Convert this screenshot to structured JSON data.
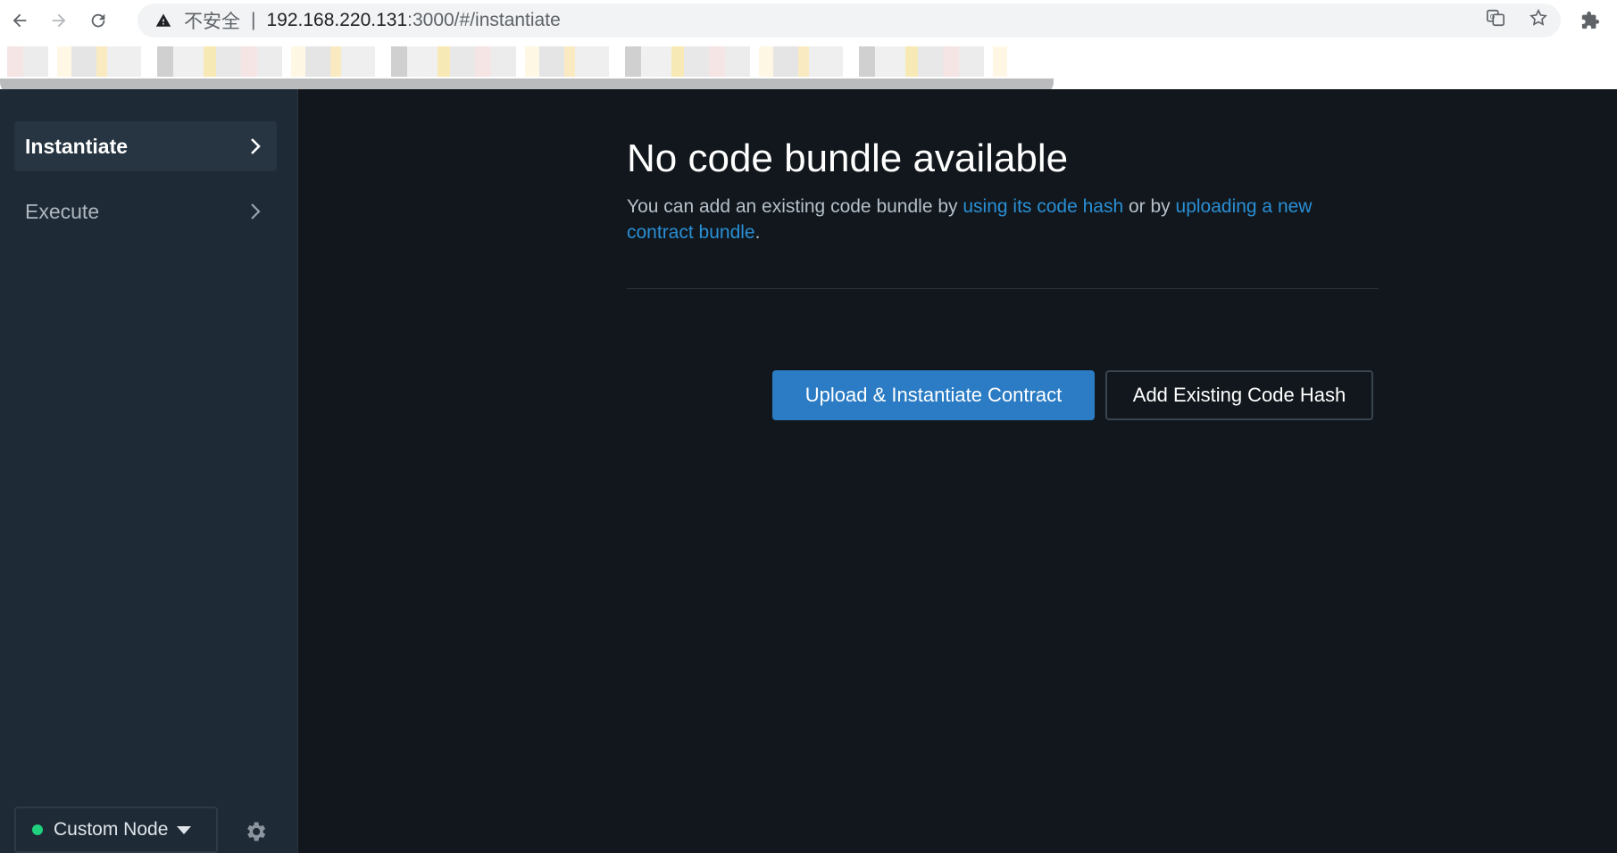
{
  "browser": {
    "insecure_label": "不安全",
    "separator": "|",
    "url_host": "192.168.220.131",
    "url_path": ":3000/#/instantiate",
    "icons": [
      "back-arrow-icon",
      "forward-arrow-icon",
      "reload-icon",
      "warning-icon",
      "translate-icon",
      "star-icon",
      "extensions-icon",
      "reading-list-icon"
    ]
  },
  "sidebar": {
    "items": [
      {
        "label": "Instantiate",
        "active": true
      },
      {
        "label": "Execute",
        "active": false
      }
    ],
    "node_selector": {
      "label": "Custom Node",
      "status_color": "#1fd17f"
    }
  },
  "main": {
    "title": "No code bundle available",
    "description": {
      "prefix": "You can add an existing code bundle by ",
      "link1": "using its code hash",
      "middle": " or by ",
      "link2": "uploading a new contract bundle",
      "suffix": "."
    },
    "primary_button": "Upload & Instantiate Contract",
    "secondary_button": "Add Existing Code Hash"
  },
  "colors": {
    "sidebar_bg": "#1e2a36",
    "main_bg": "#11171c",
    "link": "#2a8fd6",
    "primary": "#2b7cc4"
  }
}
